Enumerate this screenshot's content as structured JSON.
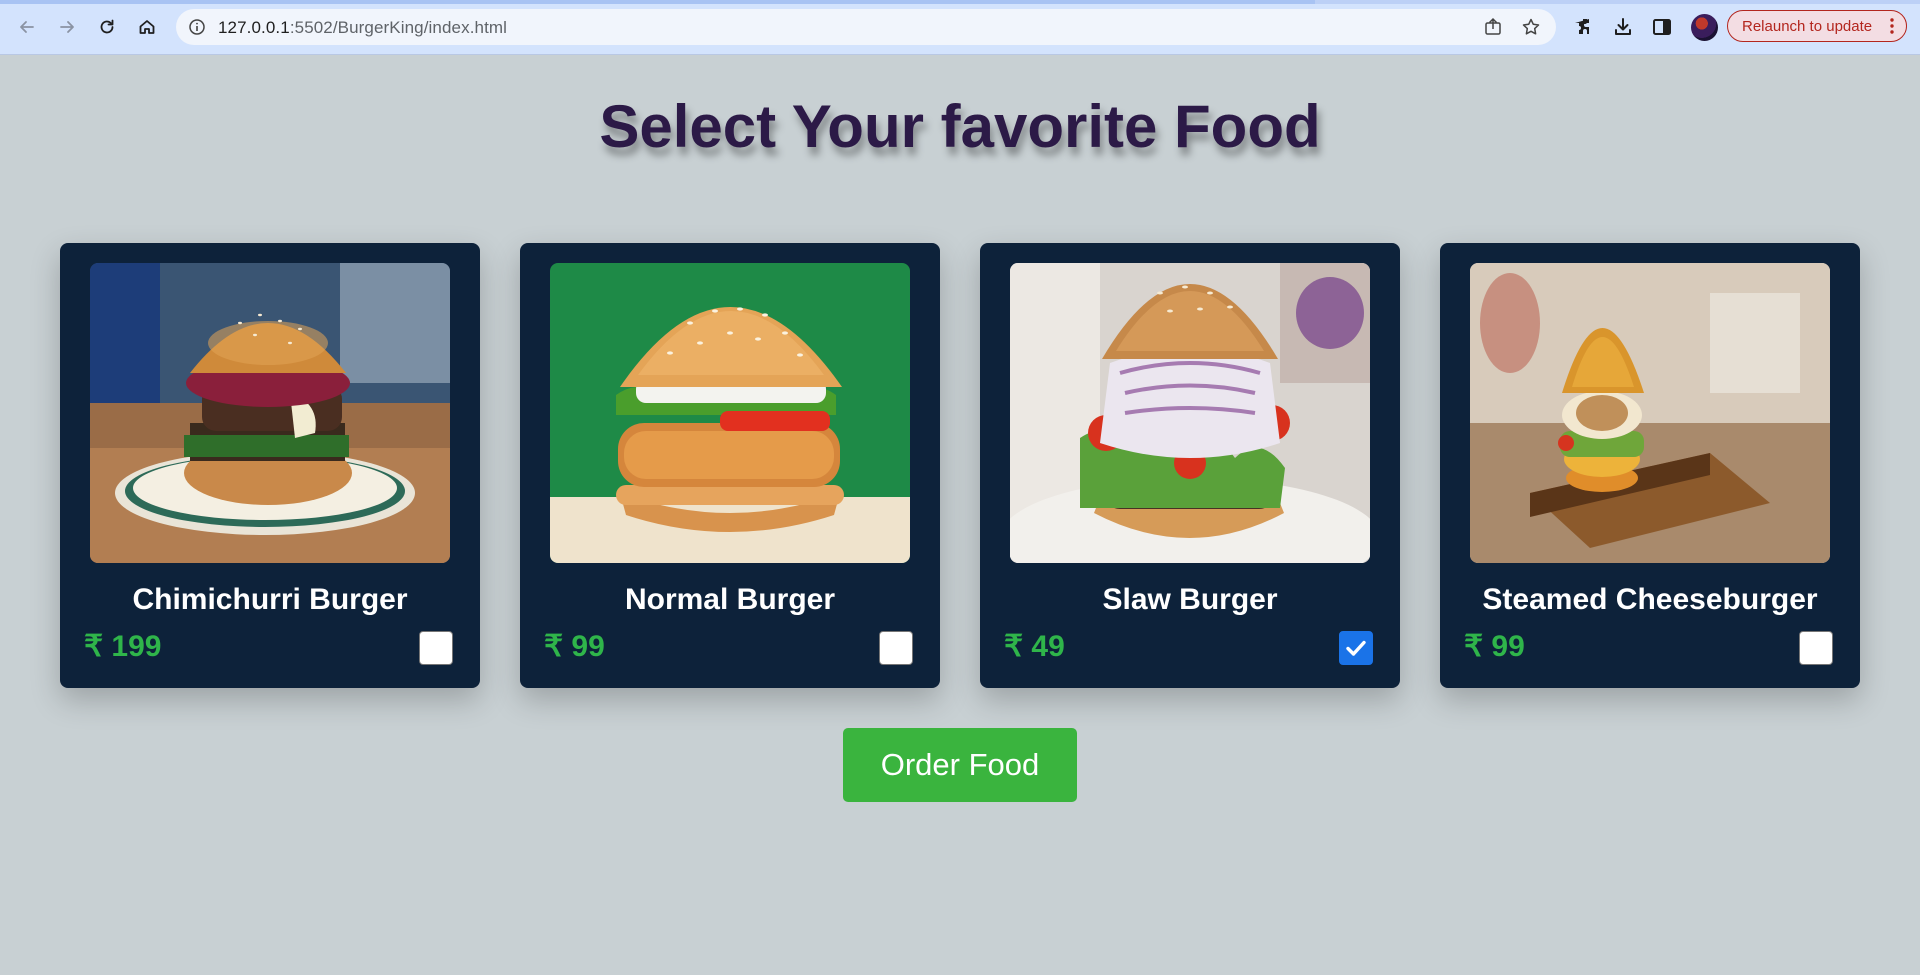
{
  "browser": {
    "url_host": "127.0.0.1",
    "url_rest": ":5502/BurgerKing/index.html",
    "relaunch_label": "Relaunch to update",
    "back_icon": "arrow-left-icon",
    "forward_icon": "arrow-right-icon",
    "reload_icon": "reload-icon",
    "home_icon": "home-icon"
  },
  "page": {
    "title": "Select Your favorite Food",
    "order_button": "Order Food",
    "accent_color": "#3ab43e",
    "card_color": "#0d223a"
  },
  "foods": [
    {
      "name": "Chimichurri Burger",
      "price": "₹ 199",
      "checked": false
    },
    {
      "name": "Normal Burger",
      "price": "₹ 99",
      "checked": false
    },
    {
      "name": "Slaw Burger",
      "price": "₹ 49",
      "checked": true
    },
    {
      "name": "Steamed Cheeseburger",
      "price": "₹ 99",
      "checked": false
    }
  ]
}
